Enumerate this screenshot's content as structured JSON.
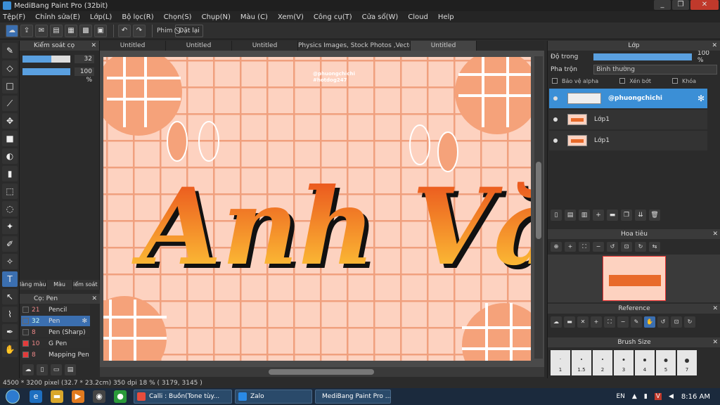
{
  "window": {
    "title": "MediBang Paint Pro (32bit)",
    "btn_min": "_",
    "btn_max": "❐",
    "btn_close": "✕"
  },
  "menu": [
    "Tệp(F)",
    "Chỉnh sửa(E)",
    "Lớp(L)",
    "Bộ lọc(R)",
    "Chọn(S)",
    "Chụp(N)",
    "Màu (C)",
    "Xem(V)",
    "Công cụ(T)",
    "Cửa sổ(W)",
    "Cloud",
    "Help"
  ],
  "toolbar": {
    "filter_label": "Phim",
    "undo_label": "Đặt lại"
  },
  "tabs": [
    "Untitled",
    "Untitled",
    "Untitled",
    "Physics Images, Stock Photos ,Vectors.jpg",
    "Untitled"
  ],
  "brush_control": {
    "title": "Kiểm soát cọ",
    "size_value": "32",
    "size_fill": 0.6,
    "opacity_value": "100 %",
    "opacity_fill": 1.0
  },
  "panel_tabs": [
    "làng màu",
    "Màu",
    "iểm soát cọ"
  ],
  "brush_panel": {
    "title": "Cọ: Pen",
    "items": [
      {
        "size": "21",
        "name": "Pencil",
        "color": "#333333"
      },
      {
        "size": "32",
        "name": "Pen",
        "color": "#3b6fb0"
      },
      {
        "size": "8",
        "name": "Pen (Sharp)",
        "color": "#333333"
      },
      {
        "size": "10",
        "name": "G Pen",
        "color": "#e33b3b"
      },
      {
        "size": "8",
        "name": "Mapping Pen",
        "color": "#e33b3b"
      }
    ]
  },
  "layer_panel": {
    "title": "Lớp",
    "opacity_label": "Độ trong",
    "opacity_value": "100 %",
    "blend_label": "Pha trộn",
    "blend_value": "Bình thường",
    "protect_alpha": "Bảo vệ alpha",
    "clipping": "Xén bớt",
    "lock": "Khóa",
    "layers": [
      {
        "name": "@phuongchichi",
        "selected": true
      },
      {
        "name": "Lớp1",
        "selected": false
      },
      {
        "name": "Lớp1",
        "selected": false
      }
    ]
  },
  "navigator": {
    "title": "Hoa tiêu"
  },
  "reference": {
    "title": "Reference"
  },
  "brush_size": {
    "title": "Brush Size",
    "sizes": [
      "1",
      "1.5",
      "2",
      "3",
      "4",
      "5",
      "7"
    ]
  },
  "canvas": {
    "text": "Anh Văn",
    "watermark_line1": "@phuongchichi",
    "watermark_line2": "#hotdog247"
  },
  "status": "4500 * 3200 pixel  (32.7 * 23.2cm)  350 dpi  18 %  ( 3179, 3145 )",
  "taskbar": {
    "tasks": [
      {
        "label": "Calli : Buồn(Tone tùy...",
        "color": "#e74c3c"
      },
      {
        "label": "Zalo",
        "color": "#2a8ae6"
      },
      {
        "label": "MediBang Paint Pro ...",
        "color": "#3a9ad9"
      }
    ],
    "lang": "EN",
    "time": "8:16 AM"
  },
  "colors": {
    "canvas_bg": "#fdd2c0",
    "grid": "#f0a07e",
    "accent": "#3b8fd6",
    "text_grad_top": "#e8461a",
    "text_grad_bottom": "#ffd23a"
  }
}
